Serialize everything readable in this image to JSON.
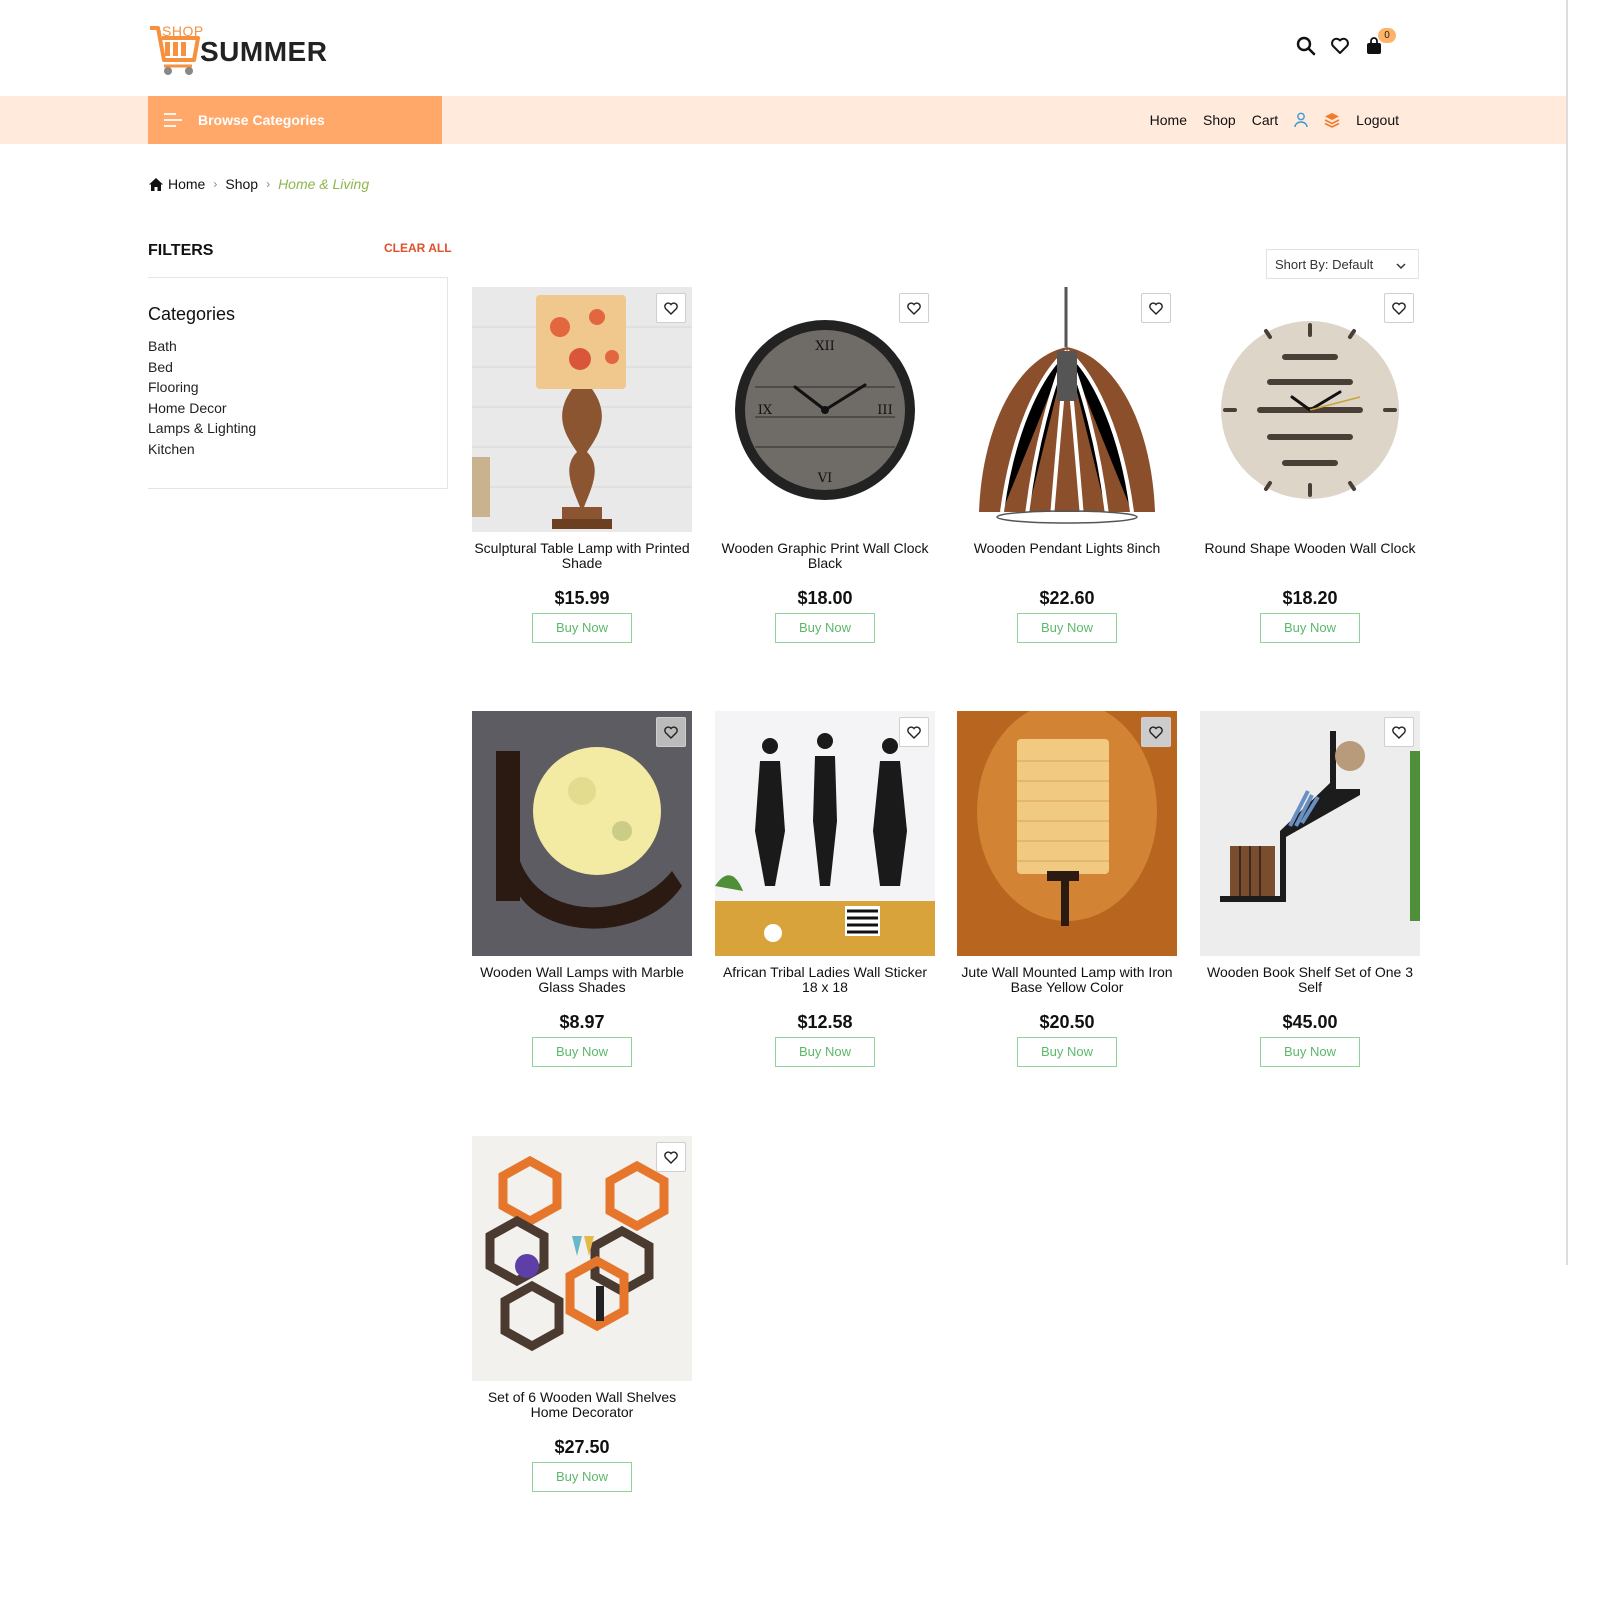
{
  "brand": {
    "shop_text": "SHOP",
    "name": "SUMMER",
    "accent_color": "#f5913f",
    "nav_bg": "#ffeadb",
    "browse_bg": "#ffa869"
  },
  "header": {
    "cart_count": "0"
  },
  "nav": {
    "browse_label": "Browse Categories",
    "links": [
      "Home",
      "Shop",
      "Cart",
      "Logout"
    ]
  },
  "breadcrumb": {
    "home": "Home",
    "shop": "Shop",
    "current": "Home & Living"
  },
  "filters": {
    "title": "FILTERS",
    "clear": "CLEAR ALL",
    "categories_title": "Categories",
    "categories": [
      "Bath",
      "Bed",
      "Flooring",
      "Home Decor",
      "Lamps & Lighting",
      "Kitchen"
    ]
  },
  "sort": {
    "label": "Short By: Default"
  },
  "products": [
    {
      "name": "Sculptural Table Lamp with Printed Shade",
      "price": "$15.99",
      "button": "Buy Now"
    },
    {
      "name": "Wooden Graphic Print Wall Clock Black",
      "price": "$18.00",
      "button": "Buy Now"
    },
    {
      "name": "Wooden Pendant Lights 8inch",
      "price": "$22.60",
      "button": "Buy Now"
    },
    {
      "name": "Round Shape Wooden Wall Clock",
      "price": "$18.20",
      "button": "Buy Now"
    },
    {
      "name": "Wooden Wall Lamps with Marble Glass Shades",
      "price": "$8.97",
      "button": "Buy Now"
    },
    {
      "name": "African Tribal Ladies Wall Sticker 18 x 18",
      "price": "$12.58",
      "button": "Buy Now"
    },
    {
      "name": "Jute Wall Mounted Lamp with Iron Base Yellow Color",
      "price": "$20.50",
      "button": "Buy Now"
    },
    {
      "name": "Wooden Book Shelf Set of One 3 Self",
      "price": "$45.00",
      "button": "Buy Now"
    },
    {
      "name": "Set of 6 Wooden Wall Shelves Home Decorator",
      "price": "$27.50",
      "button": "Buy Now"
    }
  ]
}
